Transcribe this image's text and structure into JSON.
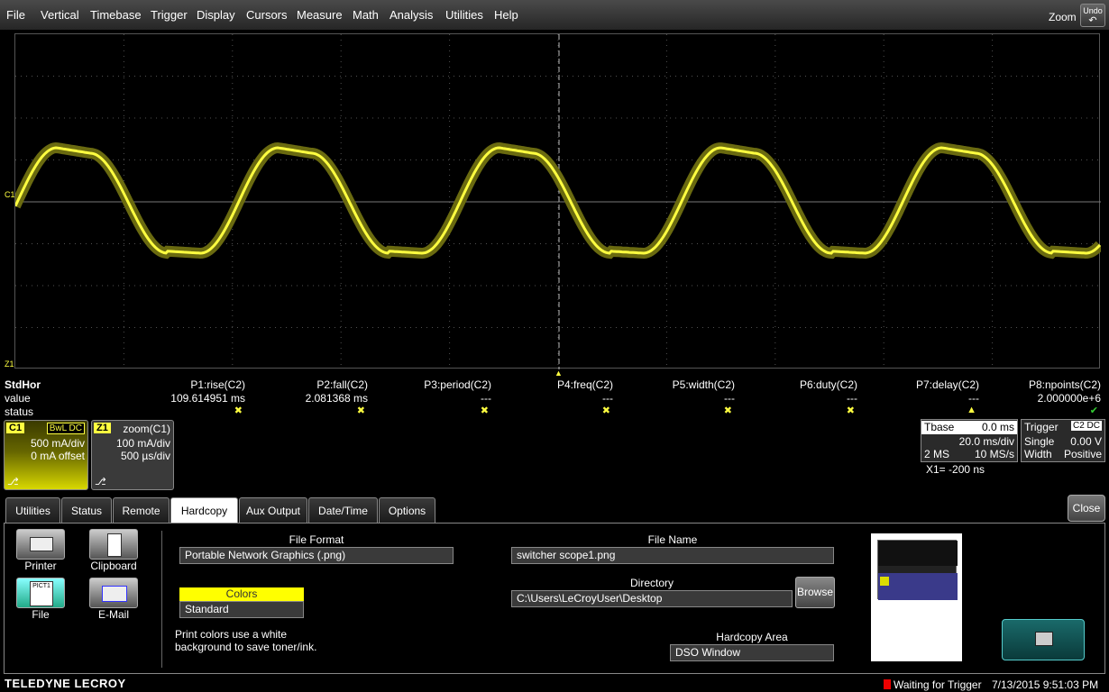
{
  "menu": [
    "File",
    "Vertical",
    "Timebase",
    "Trigger",
    "Display",
    "Cursors",
    "Measure",
    "Math",
    "Analysis",
    "Utilities",
    "Help"
  ],
  "zoom_label": "Zoom",
  "undo_label": "Undo",
  "channel_markers": {
    "c1": "C1",
    "z1": "Z1"
  },
  "measurements": {
    "row_title": "StdHor",
    "row_value": "value",
    "row_status": "status",
    "params": [
      {
        "name": "P1:rise(C2)",
        "value": "109.614951 ms",
        "status": "x"
      },
      {
        "name": "P2:fall(C2)",
        "value": "2.081368 ms",
        "status": "x"
      },
      {
        "name": "P3:period(C2)",
        "value": "---",
        "status": "x"
      },
      {
        "name": "P4:freq(C2)",
        "value": "---",
        "status": "x"
      },
      {
        "name": "P5:width(C2)",
        "value": "---",
        "status": "x"
      },
      {
        "name": "P6:duty(C2)",
        "value": "---",
        "status": "x"
      },
      {
        "name": "P7:delay(C2)",
        "value": "---",
        "status": "warning"
      },
      {
        "name": "P8:npoints(C2)",
        "value": "2.000000e+6",
        "status": "check"
      }
    ]
  },
  "c1_descriptor": {
    "tag": "C1",
    "badges": "BwL DC",
    "vdiv": "500 mA/div",
    "offset": "0 mA offset"
  },
  "z1_descriptor": {
    "tag": "Z1",
    "title": "zoom(C1)",
    "vdiv": "100 mA/div",
    "hdiv": "500 µs/div"
  },
  "timebase": {
    "label": "Tbase",
    "delay": "0.0 ms",
    "tdiv": "20.0 ms/div",
    "samples": "2 MS",
    "rate": "10 MS/s"
  },
  "trigger": {
    "label": "Trigger",
    "source": "C2 DC",
    "mode": "Single",
    "level": "0.00 V",
    "type": "Width",
    "slope": "Positive"
  },
  "x1_readout": "X1= -200 ns",
  "tabs": [
    "Utilities",
    "Status",
    "Remote",
    "Hardcopy",
    "Aux Output",
    "Date/Time",
    "Options"
  ],
  "active_tab": "Hardcopy",
  "close_label": "Close",
  "hardcopy": {
    "buttons": [
      {
        "label": "Printer",
        "icon": "printer-icon"
      },
      {
        "label": "Clipboard",
        "icon": "clipboard-icon"
      },
      {
        "label": "File",
        "icon": "file-icon",
        "icon_text": "PICT1"
      },
      {
        "label": "E-Mail",
        "icon": "email-icon"
      }
    ],
    "file_format_label": "File Format",
    "file_format_value": "Portable Network Graphics (.png)",
    "colors_label": "Colors",
    "colors_value": "Standard",
    "colors_help": "Print colors use a white background to save toner/ink.",
    "file_name_label": "File Name",
    "file_name_value": "switcher scope1.png",
    "directory_label": "Directory",
    "directory_value": "C:\\Users\\LeCroyUser\\Desktop",
    "browse_label": "Browse",
    "area_label": "Hardcopy Area",
    "area_value": "DSO Window"
  },
  "status_bar": {
    "brand": "TELEDYNE LECROY",
    "acq_status": "Waiting for Trigger",
    "datetime": "7/13/2015 9:51:03 PM"
  },
  "colors": {
    "trace": "#ffff40",
    "grid": "#505050",
    "background": "#000000"
  }
}
